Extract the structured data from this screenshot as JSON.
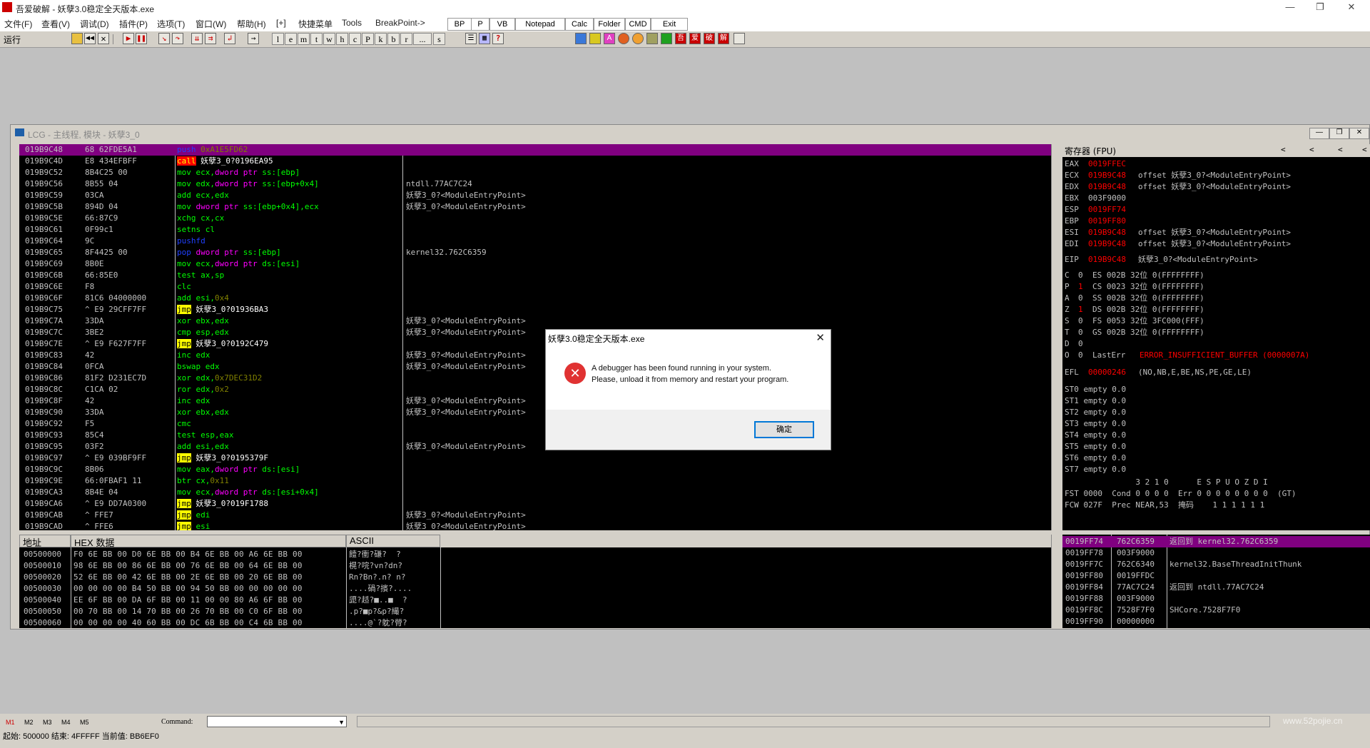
{
  "app_title": "吾爱破解 - 妖孽3.0稳定全天版本.exe",
  "window_controls": {
    "minimize": "—",
    "maximize": "❐",
    "close": "✕"
  },
  "menu": [
    "文件(F)",
    "查看(V)",
    "调试(D)",
    "插件(P)",
    "选项(T)",
    "窗口(W)",
    "帮助(H)",
    "[+]",
    "快捷菜单",
    "Tools",
    "BreakPoint->"
  ],
  "quick_buttons": [
    "BP",
    "P",
    "VB",
    "Notepad",
    "Calc",
    "Folder",
    "CMD",
    "Exit"
  ],
  "run_state": "运行",
  "toolbar_letters": [
    "l",
    "e",
    "m",
    "t",
    "w",
    "h",
    "c",
    "P",
    "k",
    "b",
    "r",
    "...",
    "s"
  ],
  "plugin_icons": [
    "吾",
    "爱",
    "破",
    "解"
  ],
  "cpu_window_title": "LCG - 主线程, 模块 - 妖孽3_0",
  "cpu_buttons": [
    "—",
    "❐",
    "✕"
  ],
  "colors": {
    "selection": "#800080",
    "asm_mnemonic": "#00ff00",
    "asm_jump": "#ffff00",
    "asm_call_bg": "#ff0000",
    "asm_number": "#808000",
    "asm_ptr": "#ff00ff",
    "reg_changed": "#ff0000",
    "comment": "#c0c0c0"
  },
  "disasm": [
    {
      "addr": "019B9C48",
      "hex": "68 62FDE5A1",
      "ops": [
        {
          "t": "push",
          "c": "b"
        },
        {
          "t": " 0xA1E5FD62",
          "c": "n"
        }
      ],
      "cmt": "",
      "sel": true
    },
    {
      "addr": "019B9C4D",
      "hex": "E8 434EFBFF",
      "ops": [
        {
          "t": "call",
          "c": "call"
        },
        {
          "t": " 妖孽3_0?0196EA95",
          "c": "w"
        }
      ],
      "cmt": ""
    },
    {
      "addr": "019B9C52",
      "hex": "8B4C25 00",
      "ops": [
        {
          "t": "mov",
          "c": "g"
        },
        {
          "t": " ecx,",
          "c": "g"
        },
        {
          "t": "dword ptr",
          "c": "p"
        },
        {
          "t": " ss:[ebp]",
          "c": "g"
        }
      ],
      "cmt": ""
    },
    {
      "addr": "019B9C56",
      "hex": "8B55 04",
      "ops": [
        {
          "t": "mov",
          "c": "g"
        },
        {
          "t": " edx,",
          "c": "g"
        },
        {
          "t": "dword ptr",
          "c": "p"
        },
        {
          "t": " ss:[ebp+0x4]",
          "c": "g"
        }
      ],
      "cmt": "ntdll.77AC7C24"
    },
    {
      "addr": "019B9C59",
      "hex": "03CA",
      "ops": [
        {
          "t": "add",
          "c": "g"
        },
        {
          "t": " ecx,edx",
          "c": "g"
        }
      ],
      "cmt": "妖孽3_0?<ModuleEntryPoint>"
    },
    {
      "addr": "019B9C5B",
      "hex": "894D 04",
      "ops": [
        {
          "t": "mov",
          "c": "g"
        },
        {
          "t": " dword ptr",
          "c": "p"
        },
        {
          "t": " ss:[ebp+0x4],ecx",
          "c": "g"
        }
      ],
      "cmt": "妖孽3_0?<ModuleEntryPoint>"
    },
    {
      "addr": "019B9C5E",
      "hex": "66:87C9",
      "ops": [
        {
          "t": "xchg",
          "c": "g"
        },
        {
          "t": " cx,cx",
          "c": "g"
        }
      ],
      "cmt": ""
    },
    {
      "addr": "019B9C61",
      "hex": "0F99c1",
      "ops": [
        {
          "t": "setns",
          "c": "g"
        },
        {
          "t": " cl",
          "c": "g"
        }
      ],
      "cmt": ""
    },
    {
      "addr": "019B9C64",
      "hex": "9C",
      "ops": [
        {
          "t": "pushfd",
          "c": "b"
        }
      ],
      "cmt": ""
    },
    {
      "addr": "019B9C65",
      "hex": "8F4425 00",
      "ops": [
        {
          "t": "pop",
          "c": "b"
        },
        {
          "t": " dword ptr",
          "c": "p"
        },
        {
          "t": " ss:[ebp]",
          "c": "g"
        }
      ],
      "cmt": "kernel32.762C6359"
    },
    {
      "addr": "019B9C69",
      "hex": "8B0E",
      "ops": [
        {
          "t": "mov",
          "c": "g"
        },
        {
          "t": " ecx,",
          "c": "g"
        },
        {
          "t": "dword ptr",
          "c": "p"
        },
        {
          "t": " ds:[esi]",
          "c": "g"
        }
      ],
      "cmt": ""
    },
    {
      "addr": "019B9C6B",
      "hex": "66:85E0",
      "ops": [
        {
          "t": "test",
          "c": "g"
        },
        {
          "t": " ax,sp",
          "c": "g"
        }
      ],
      "cmt": ""
    },
    {
      "addr": "019B9C6E",
      "hex": "F8",
      "ops": [
        {
          "t": "clc",
          "c": "g"
        }
      ],
      "cmt": ""
    },
    {
      "addr": "019B9C6F",
      "hex": "81C6 04000000",
      "ops": [
        {
          "t": "add",
          "c": "g"
        },
        {
          "t": " esi,",
          "c": "g"
        },
        {
          "t": "0x4",
          "c": "n"
        }
      ],
      "cmt": ""
    },
    {
      "addr": "019B9C75",
      "hex": "^ E9 29CFF7FF",
      "ops": [
        {
          "t": "jmp",
          "c": "jmp"
        },
        {
          "t": " 妖孽3_0?01936BA3",
          "c": "w"
        }
      ],
      "cmt": ""
    },
    {
      "addr": "019B9C7A",
      "hex": "33DA",
      "ops": [
        {
          "t": "xor",
          "c": "g"
        },
        {
          "t": " ebx,edx",
          "c": "g"
        }
      ],
      "cmt": "妖孽3_0?<ModuleEntryPoint>"
    },
    {
      "addr": "019B9C7C",
      "hex": "3BE2",
      "ops": [
        {
          "t": "cmp",
          "c": "g"
        },
        {
          "t": " esp,edx",
          "c": "g"
        }
      ],
      "cmt": "妖孽3_0?<ModuleEntryPoint>"
    },
    {
      "addr": "019B9C7E",
      "hex": "^ E9 F627F7FF",
      "ops": [
        {
          "t": "jmp",
          "c": "jmp"
        },
        {
          "t": " 妖孽3_0?0192C479",
          "c": "w"
        }
      ],
      "cmt": ""
    },
    {
      "addr": "019B9C83",
      "hex": "42",
      "ops": [
        {
          "t": "inc",
          "c": "g"
        },
        {
          "t": " edx",
          "c": "g"
        }
      ],
      "cmt": "妖孽3_0?<ModuleEntryPoint>"
    },
    {
      "addr": "019B9C84",
      "hex": "0FCA",
      "ops": [
        {
          "t": "bswap",
          "c": "g"
        },
        {
          "t": " edx",
          "c": "g"
        }
      ],
      "cmt": "妖孽3_0?<ModuleEntryPoint>"
    },
    {
      "addr": "019B9C86",
      "hex": "81F2 D231EC7D",
      "ops": [
        {
          "t": "xor",
          "c": "g"
        },
        {
          "t": " edx,",
          "c": "g"
        },
        {
          "t": "0x7DEC31D2",
          "c": "n"
        }
      ],
      "cmt": ""
    },
    {
      "addr": "019B9C8C",
      "hex": "C1CA 02",
      "ops": [
        {
          "t": "ror",
          "c": "g"
        },
        {
          "t": " edx,",
          "c": "g"
        },
        {
          "t": "0x2",
          "c": "n"
        }
      ],
      "cmt": ""
    },
    {
      "addr": "019B9C8F",
      "hex": "42",
      "ops": [
        {
          "t": "inc",
          "c": "g"
        },
        {
          "t": " edx",
          "c": "g"
        }
      ],
      "cmt": "妖孽3_0?<ModuleEntryPoint>"
    },
    {
      "addr": "019B9C90",
      "hex": "33DA",
      "ops": [
        {
          "t": "xor",
          "c": "g"
        },
        {
          "t": " ebx,edx",
          "c": "g"
        }
      ],
      "cmt": "妖孽3_0?<ModuleEntryPoint>"
    },
    {
      "addr": "019B9C92",
      "hex": "F5",
      "ops": [
        {
          "t": "cmc",
          "c": "g"
        }
      ],
      "cmt": ""
    },
    {
      "addr": "019B9C93",
      "hex": "85C4",
      "ops": [
        {
          "t": "test",
          "c": "g"
        },
        {
          "t": " esp,eax",
          "c": "g"
        }
      ],
      "cmt": ""
    },
    {
      "addr": "019B9C95",
      "hex": "03F2",
      "ops": [
        {
          "t": "add",
          "c": "g"
        },
        {
          "t": " esi,edx",
          "c": "g"
        }
      ],
      "cmt": "妖孽3_0?<ModuleEntryPoint>"
    },
    {
      "addr": "019B9C97",
      "hex": "^ E9 039BF9FF",
      "ops": [
        {
          "t": "jmp",
          "c": "jmp"
        },
        {
          "t": " 妖孽3_0?0195379F",
          "c": "w"
        }
      ],
      "cmt": ""
    },
    {
      "addr": "019B9C9C",
      "hex": "8B06",
      "ops": [
        {
          "t": "mov",
          "c": "g"
        },
        {
          "t": " eax,",
          "c": "g"
        },
        {
          "t": "dword ptr",
          "c": "p"
        },
        {
          "t": " ds:[esi]",
          "c": "g"
        }
      ],
      "cmt": ""
    },
    {
      "addr": "019B9C9E",
      "hex": "66:0FBAF1 11",
      "ops": [
        {
          "t": "btr",
          "c": "g"
        },
        {
          "t": " cx,",
          "c": "g"
        },
        {
          "t": "0x11",
          "c": "n"
        }
      ],
      "cmt": ""
    },
    {
      "addr": "019B9CA3",
      "hex": "8B4E 04",
      "ops": [
        {
          "t": "mov",
          "c": "g"
        },
        {
          "t": " ecx,",
          "c": "g"
        },
        {
          "t": "dword ptr",
          "c": "p"
        },
        {
          "t": " ds:[esi+0x4]",
          "c": "g"
        }
      ],
      "cmt": ""
    },
    {
      "addr": "019B9CA6",
      "hex": "^ E9 DD7A0300",
      "ops": [
        {
          "t": "jmp",
          "c": "jmp"
        },
        {
          "t": " 妖孽3_0?019F1788",
          "c": "w"
        }
      ],
      "cmt": ""
    },
    {
      "addr": "019B9CAB",
      "hex": "^ FFE7",
      "ops": [
        {
          "t": "jmp",
          "c": "jmp"
        },
        {
          "t": " edi",
          "c": "g"
        }
      ],
      "cmt": "妖孽3_0?<ModuleEntryPoint>"
    },
    {
      "addr": "019B9CAD",
      "hex": "^ FFE6",
      "ops": [
        {
          "t": "jmp",
          "c": "jmp"
        },
        {
          "t": " esi",
          "c": "g"
        }
      ],
      "cmt": "妖孽3_0?<ModuleEntryPoint>"
    }
  ],
  "registers_header": "寄存器 (FPU)",
  "reg_nav": [
    "<",
    "<",
    "<",
    "<"
  ],
  "registers": [
    {
      "name": "EAX",
      "val": "0019FFEC",
      "red": true,
      "note": ""
    },
    {
      "name": "ECX",
      "val": "019B9C48",
      "red": true,
      "note": "offset 妖孽3_0?<ModuleEntryPoint>"
    },
    {
      "name": "EDX",
      "val": "019B9C48",
      "red": true,
      "note": "offset 妖孽3_0?<ModuleEntryPoint>"
    },
    {
      "name": "EBX",
      "val": "003F9000",
      "red": false,
      "note": ""
    },
    {
      "name": "ESP",
      "val": "0019FF74",
      "red": true,
      "note": ""
    },
    {
      "name": "EBP",
      "val": "0019FF80",
      "red": true,
      "note": ""
    },
    {
      "name": "ESI",
      "val": "019B9C48",
      "red": true,
      "note": "offset 妖孽3_0?<ModuleEntryPoint>"
    },
    {
      "name": "EDI",
      "val": "019B9C48",
      "red": true,
      "note": "offset 妖孽3_0?<ModuleEntryPoint>"
    }
  ],
  "eip": {
    "name": "EIP",
    "val": "019B9C48",
    "note": "妖孽3_0?<ModuleEntryPoint>"
  },
  "flags": [
    {
      "f": "C",
      "v": "0",
      "red": false,
      "seg": "ES 002B 32位 0(FFFFFFFF)"
    },
    {
      "f": "P",
      "v": "1",
      "red": true,
      "seg": "CS 0023 32位 0(FFFFFFFF)"
    },
    {
      "f": "A",
      "v": "0",
      "red": false,
      "seg": "SS 002B 32位 0(FFFFFFFF)"
    },
    {
      "f": "Z",
      "v": "1",
      "red": true,
      "seg": "DS 002B 32位 0(FFFFFFFF)"
    },
    {
      "f": "S",
      "v": "0",
      "red": false,
      "seg": "FS 0053 32位 3FC000(FFF)"
    },
    {
      "f": "T",
      "v": "0",
      "red": false,
      "seg": "GS 002B 32位 0(FFFFFFFF)"
    },
    {
      "f": "D",
      "v": "0",
      "red": false,
      "seg": ""
    }
  ],
  "lasterr": {
    "f": "O",
    "v": "0",
    "label": "LastErr",
    "val": "ERROR_INSUFFICIENT_BUFFER (0000007A)"
  },
  "efl": {
    "label": "EFL",
    "val": "00000246",
    "note": "(NO,NB,E,BE,NS,PE,GE,LE)"
  },
  "fpu": [
    "ST0 empty 0.0",
    "ST1 empty 0.0",
    "ST2 empty 0.0",
    "ST3 empty 0.0",
    "ST4 empty 0.0",
    "ST5 empty 0.0",
    "ST6 empty 0.0",
    "ST7 empty 0.0"
  ],
  "fpu_status": [
    "               3 2 1 0      E S P U O Z D I",
    "FST 0000  Cond 0 0 0 0  Err 0 0 0 0 0 0 0 0  (GT)",
    "FCW 027F  Prec NEAR,53  掩码    1 1 1 1 1 1"
  ],
  "dump_headers": {
    "addr": "地址",
    "hex": "HEX 数据",
    "ascii": "ASCII"
  },
  "dump": [
    {
      "addr": "00500000",
      "hex": "F0 6E BB 00 D0 6E BB 00 B4 6E BB 00 A6 6E BB 00",
      "ascii": "饐?衝?磏?  ?"
    },
    {
      "addr": "00500010",
      "hex": "98 6E BB 00 86 6E BB 00 76 6E BB 00 64 6E BB 00",
      "ascii": "榥?唍?vn?dn?"
    },
    {
      "addr": "00500020",
      "hex": "52 6E BB 00 42 6E BB 00 2E 6E BB 00 20 6E BB 00",
      "ascii": "Rn?Bn?.n? n?"
    },
    {
      "addr": "00500030",
      "hex": "00 00 00 00 B4 50 BB 00 94 50 BB 00 00 00 00 00",
      "ascii": "....碢?擯?...."
    },
    {
      "addr": "00500040",
      "hex": "EE 6F BB 00 DA 6F BB 00 11 00 00 80 A6 6F BB 00",
      "ascii": "頾?趏?■..■  ?"
    },
    {
      "addr": "00500050",
      "hex": "00 70 BB 00 14 70 BB 00 26 70 BB 00 C0 6F BB 00",
      "ascii": ".p?■p?&p?繓?"
    },
    {
      "addr": "00500060",
      "hex": "00 00 00 00 40 60 BB 00 DC 6B BB 00 C4 6B BB 00",
      "ascii": "....@`?躭?膋?"
    }
  ],
  "stack": [
    {
      "addr": "0019FF74",
      "val": "762C6359",
      "cmt": "返回到 kernel32.762C6359",
      "sel": true
    },
    {
      "addr": "0019FF78",
      "val": "003F9000",
      "cmt": ""
    },
    {
      "addr": "0019FF7C",
      "val": "762C6340",
      "cmt": "kernel32.BaseThreadInitThunk"
    },
    {
      "addr": "0019FF80",
      "val": "0019FFDC",
      "cmt": ""
    },
    {
      "addr": "0019FF84",
      "val": "77AC7C24",
      "cmt": "返回到 ntdll.77AC7C24"
    },
    {
      "addr": "0019FF88",
      "val": "003F9000",
      "cmt": ""
    },
    {
      "addr": "0019FF8C",
      "val": "7528F7F0",
      "cmt": "SHCore.7528F7F0"
    },
    {
      "addr": "0019FF90",
      "val": "00000000",
      "cmt": ""
    }
  ],
  "dialog": {
    "title": "妖孽3.0稳定全天版本.exe",
    "close": "✕",
    "line1": "A debugger has been found running in your system.",
    "line2": "Please, unload it from memory and restart your program.",
    "ok": "确定",
    "icon": "✕"
  },
  "bookmarks": [
    "M1",
    "M2",
    "M3",
    "M4",
    "M5"
  ],
  "command_label": "Command:",
  "command_value": "",
  "status_text": "起始: 500000 结束: 4FFFFF 当前值: BB6EF0",
  "watermark": "www.52pojie.cn"
}
